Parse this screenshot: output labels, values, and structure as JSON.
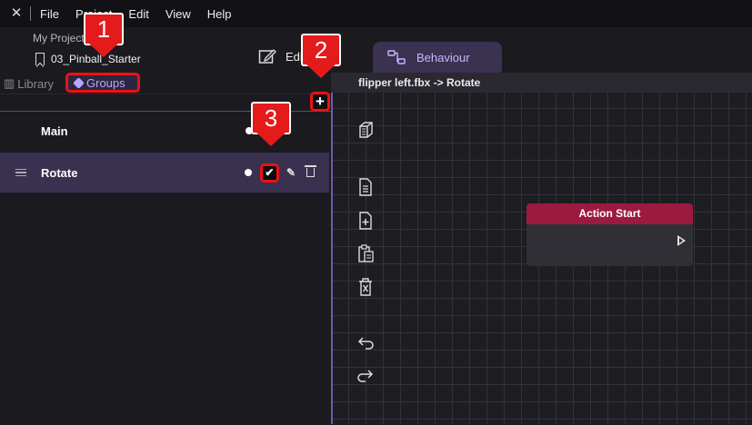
{
  "menubar": {
    "app_icon": "app-logo-icon",
    "items": [
      "File",
      "Project",
      "Edit",
      "View",
      "Help"
    ]
  },
  "project": {
    "label": "My Project",
    "name": "03_Pinball_Starter"
  },
  "tabs": {
    "edit_label": "Edit",
    "behaviour_label": "Behaviour"
  },
  "panel_tabs": {
    "library_label": "Library",
    "groups_label": "Groups"
  },
  "groups": [
    {
      "name": "Main"
    },
    {
      "name": "Rotate"
    }
  ],
  "canvas": {
    "header": "flipper left.fbx -> Rotate",
    "node_title": "Action Start",
    "toolbar_icons": [
      "object-icon",
      "document-icon",
      "add-document-icon",
      "paste-icon",
      "delete-icon",
      "undo-icon",
      "redo-icon"
    ]
  },
  "callouts": [
    "1",
    "2",
    "3"
  ],
  "colors": {
    "accent": "#b7a6ff",
    "highlight": "#e41b1b",
    "node_header": "#9c1a3f",
    "selected_row": "#3a3150"
  }
}
